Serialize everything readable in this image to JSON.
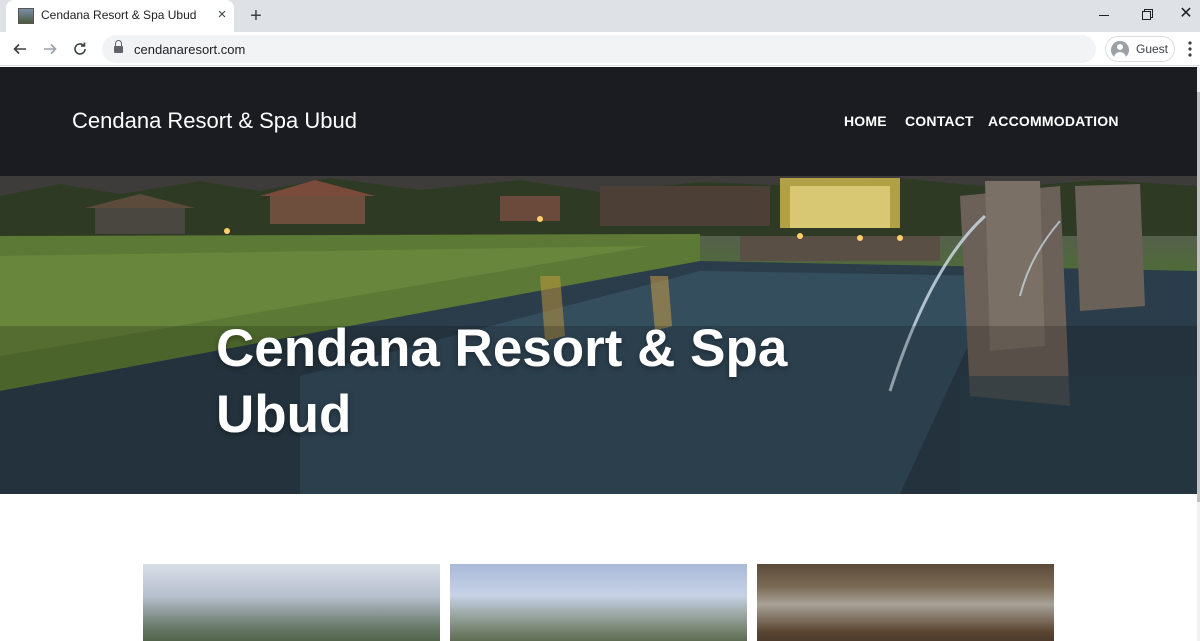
{
  "browser": {
    "tab_title": "Cendana Resort & Spa Ubud",
    "tab_close": "×",
    "new_tab": "+",
    "window_close": "✕",
    "url": "cendanaresort.com",
    "profile_label": "Guest",
    "icons": [
      "favicon",
      "close-icon",
      "plus-icon",
      "minimize-icon",
      "restore-icon",
      "back-arrow-icon",
      "forward-arrow-icon",
      "reload-icon",
      "lock-icon",
      "avatar-icon",
      "kebab-menu-icon"
    ]
  },
  "site": {
    "brand": "Cendana Resort & Spa Ubud",
    "nav": {
      "home": "HOME",
      "contact": "CONTACT",
      "accommodation": "ACCOMMODATION"
    },
    "hero": {
      "title": "Cendana Resort & Spa Ubud"
    },
    "colors": {
      "header_bg": "#1b1c21",
      "text": "#ffffff"
    }
  }
}
